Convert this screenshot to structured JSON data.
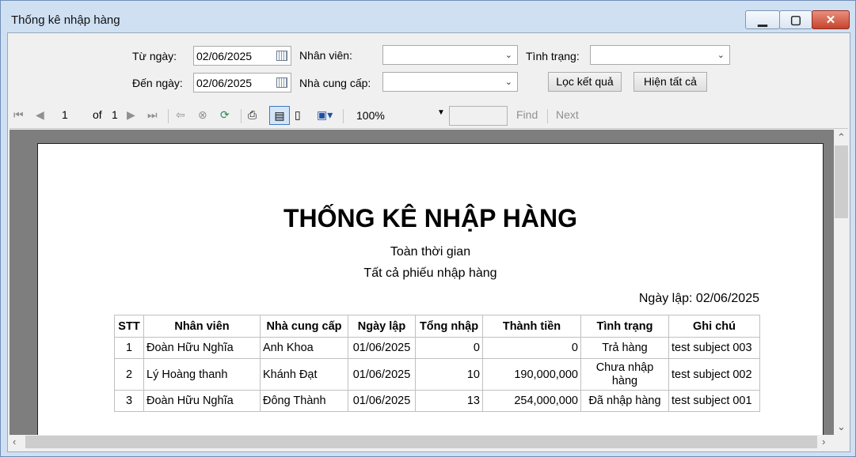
{
  "window": {
    "title": "Thống kê nhập hàng"
  },
  "filters": {
    "from_label": "Từ ngày:",
    "from_value": "02/06/2025",
    "to_label": "Đến ngày:",
    "to_value": "02/06/2025",
    "employee_label": "Nhân viên:",
    "employee_value": "",
    "supplier_label": "Nhà cung cấp:",
    "supplier_value": "",
    "status_label": "Tình trạng:",
    "status_value": "",
    "filter_button": "Lọc kết quả",
    "show_all_button": "Hiện tất cả"
  },
  "toolbar": {
    "page_value": "1",
    "of_label": "of",
    "total_pages": "1",
    "zoom": "100%",
    "find_label": "Find",
    "next_label": "Next"
  },
  "report": {
    "title": "THỐNG KÊ NHẬP HÀNG",
    "subtitle1": "Toàn thời gian",
    "subtitle2": "Tất cả phiếu nhập hàng",
    "date_line": "Ngày lập: 02/06/2025",
    "columns": [
      "STT",
      "Nhân viên",
      "Nhà cung cấp",
      "Ngày lập",
      "Tổng nhập",
      "Thành tiền",
      "Tình trạng",
      "Ghi chú"
    ],
    "rows": [
      [
        "1",
        "Đoàn Hữu Nghĩa",
        "Anh Khoa",
        "01/06/2025",
        "0",
        "0",
        "Trả hàng",
        "test subject 003"
      ],
      [
        "2",
        "Lý Hoàng thanh",
        "Khánh Đạt",
        "01/06/2025",
        "10",
        "190,000,000",
        "Chưa nhập hàng",
        "test subject 002"
      ],
      [
        "3",
        "Đoàn Hữu Nghĩa",
        "Đông Thành",
        "01/06/2025",
        "13",
        "254,000,000",
        "Đã nhập hàng",
        "test subject 001"
      ]
    ]
  },
  "icons": [
    "first-page-icon",
    "prev-page-icon",
    "next-page-icon",
    "last-page-icon",
    "back-icon",
    "stop-icon",
    "refresh-icon",
    "print-icon",
    "print-layout-icon",
    "page-setup-icon",
    "export-icon"
  ]
}
